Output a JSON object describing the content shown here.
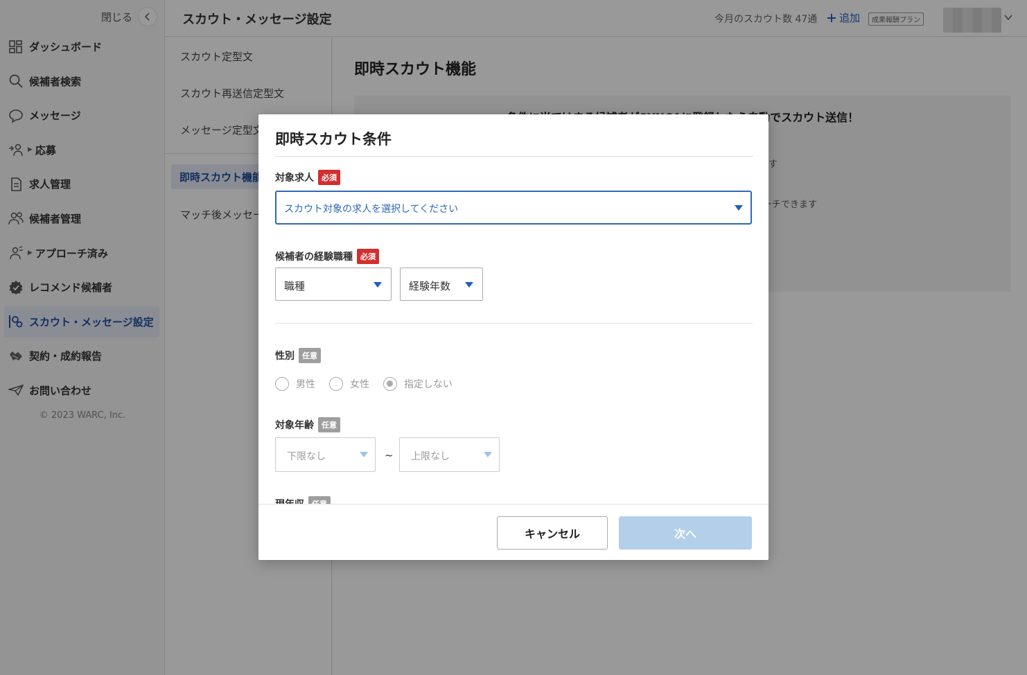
{
  "sidebar": {
    "close_label": "閉じる",
    "items": [
      {
        "label": "ダッシュボード",
        "icon": "dashboard-icon",
        "caret": false
      },
      {
        "label": "候補者検索",
        "icon": "search-icon",
        "caret": false
      },
      {
        "label": "メッセージ",
        "icon": "chat-bubble-icon",
        "caret": false
      },
      {
        "label": "応募",
        "icon": "applicant-icon",
        "caret": true
      },
      {
        "label": "求人管理",
        "icon": "document-icon",
        "caret": false
      },
      {
        "label": "候補者管理",
        "icon": "users-icon",
        "caret": false
      },
      {
        "label": "アプローチ済み",
        "icon": "approach-icon",
        "caret": true
      },
      {
        "label": "レコメンド候補者",
        "icon": "recommend-badge-icon",
        "caret": false
      },
      {
        "label": "スカウト・メッセージ設定",
        "icon": "scout-settings-icon",
        "caret": false,
        "active": true
      },
      {
        "label": "契約・成約報告",
        "icon": "handshake-icon",
        "caret": false
      },
      {
        "label": "お問い合わせ",
        "icon": "paper-plane-icon",
        "caret": false
      }
    ],
    "copyright": "© 2023 WARC, Inc."
  },
  "header": {
    "title": "スカウト・メッセージ設定",
    "scout_count": "今月のスカウト数 47通",
    "add_label": "追加",
    "plan_badge": "成果報酬プラン"
  },
  "submenu": {
    "items": [
      "スカウト定型文",
      "スカウト再送信定型文",
      "メッセージ定型文"
    ],
    "active_item": "即時スカウト機能",
    "after_item": "マッチ後メッセージ"
  },
  "main": {
    "title": "即時スカウト機能",
    "headline": "条件に当てはまる候補者がSYNCAに登録したら自動でスカウト送信！",
    "line1": "す",
    "line2": "ーチできます"
  },
  "modal": {
    "title": "即時スカウト条件",
    "target_job": {
      "label": "対象求人",
      "badge": "必須",
      "placeholder": "スカウト対象の求人を選択してください"
    },
    "experience": {
      "label": "候補者の経験職種",
      "badge": "必須",
      "job_type": "職種",
      "years": "経験年数"
    },
    "gender": {
      "label": "性別",
      "badge": "任意",
      "options": [
        "男性",
        "女性",
        "指定しない"
      ],
      "selected": "指定しない"
    },
    "age": {
      "label": "対象年齢",
      "badge": "任意",
      "min": "下限なし",
      "tilde": "~",
      "max": "上限なし"
    },
    "income": {
      "label": "現年収",
      "badge": "任意"
    },
    "cancel_label": "キャンセル",
    "next_label": "次へ"
  },
  "colors": {
    "accent": "#1f5fbf",
    "required": "#d32f2f",
    "optional": "#9e9e9e",
    "next_disabled": "#b3cfea"
  }
}
